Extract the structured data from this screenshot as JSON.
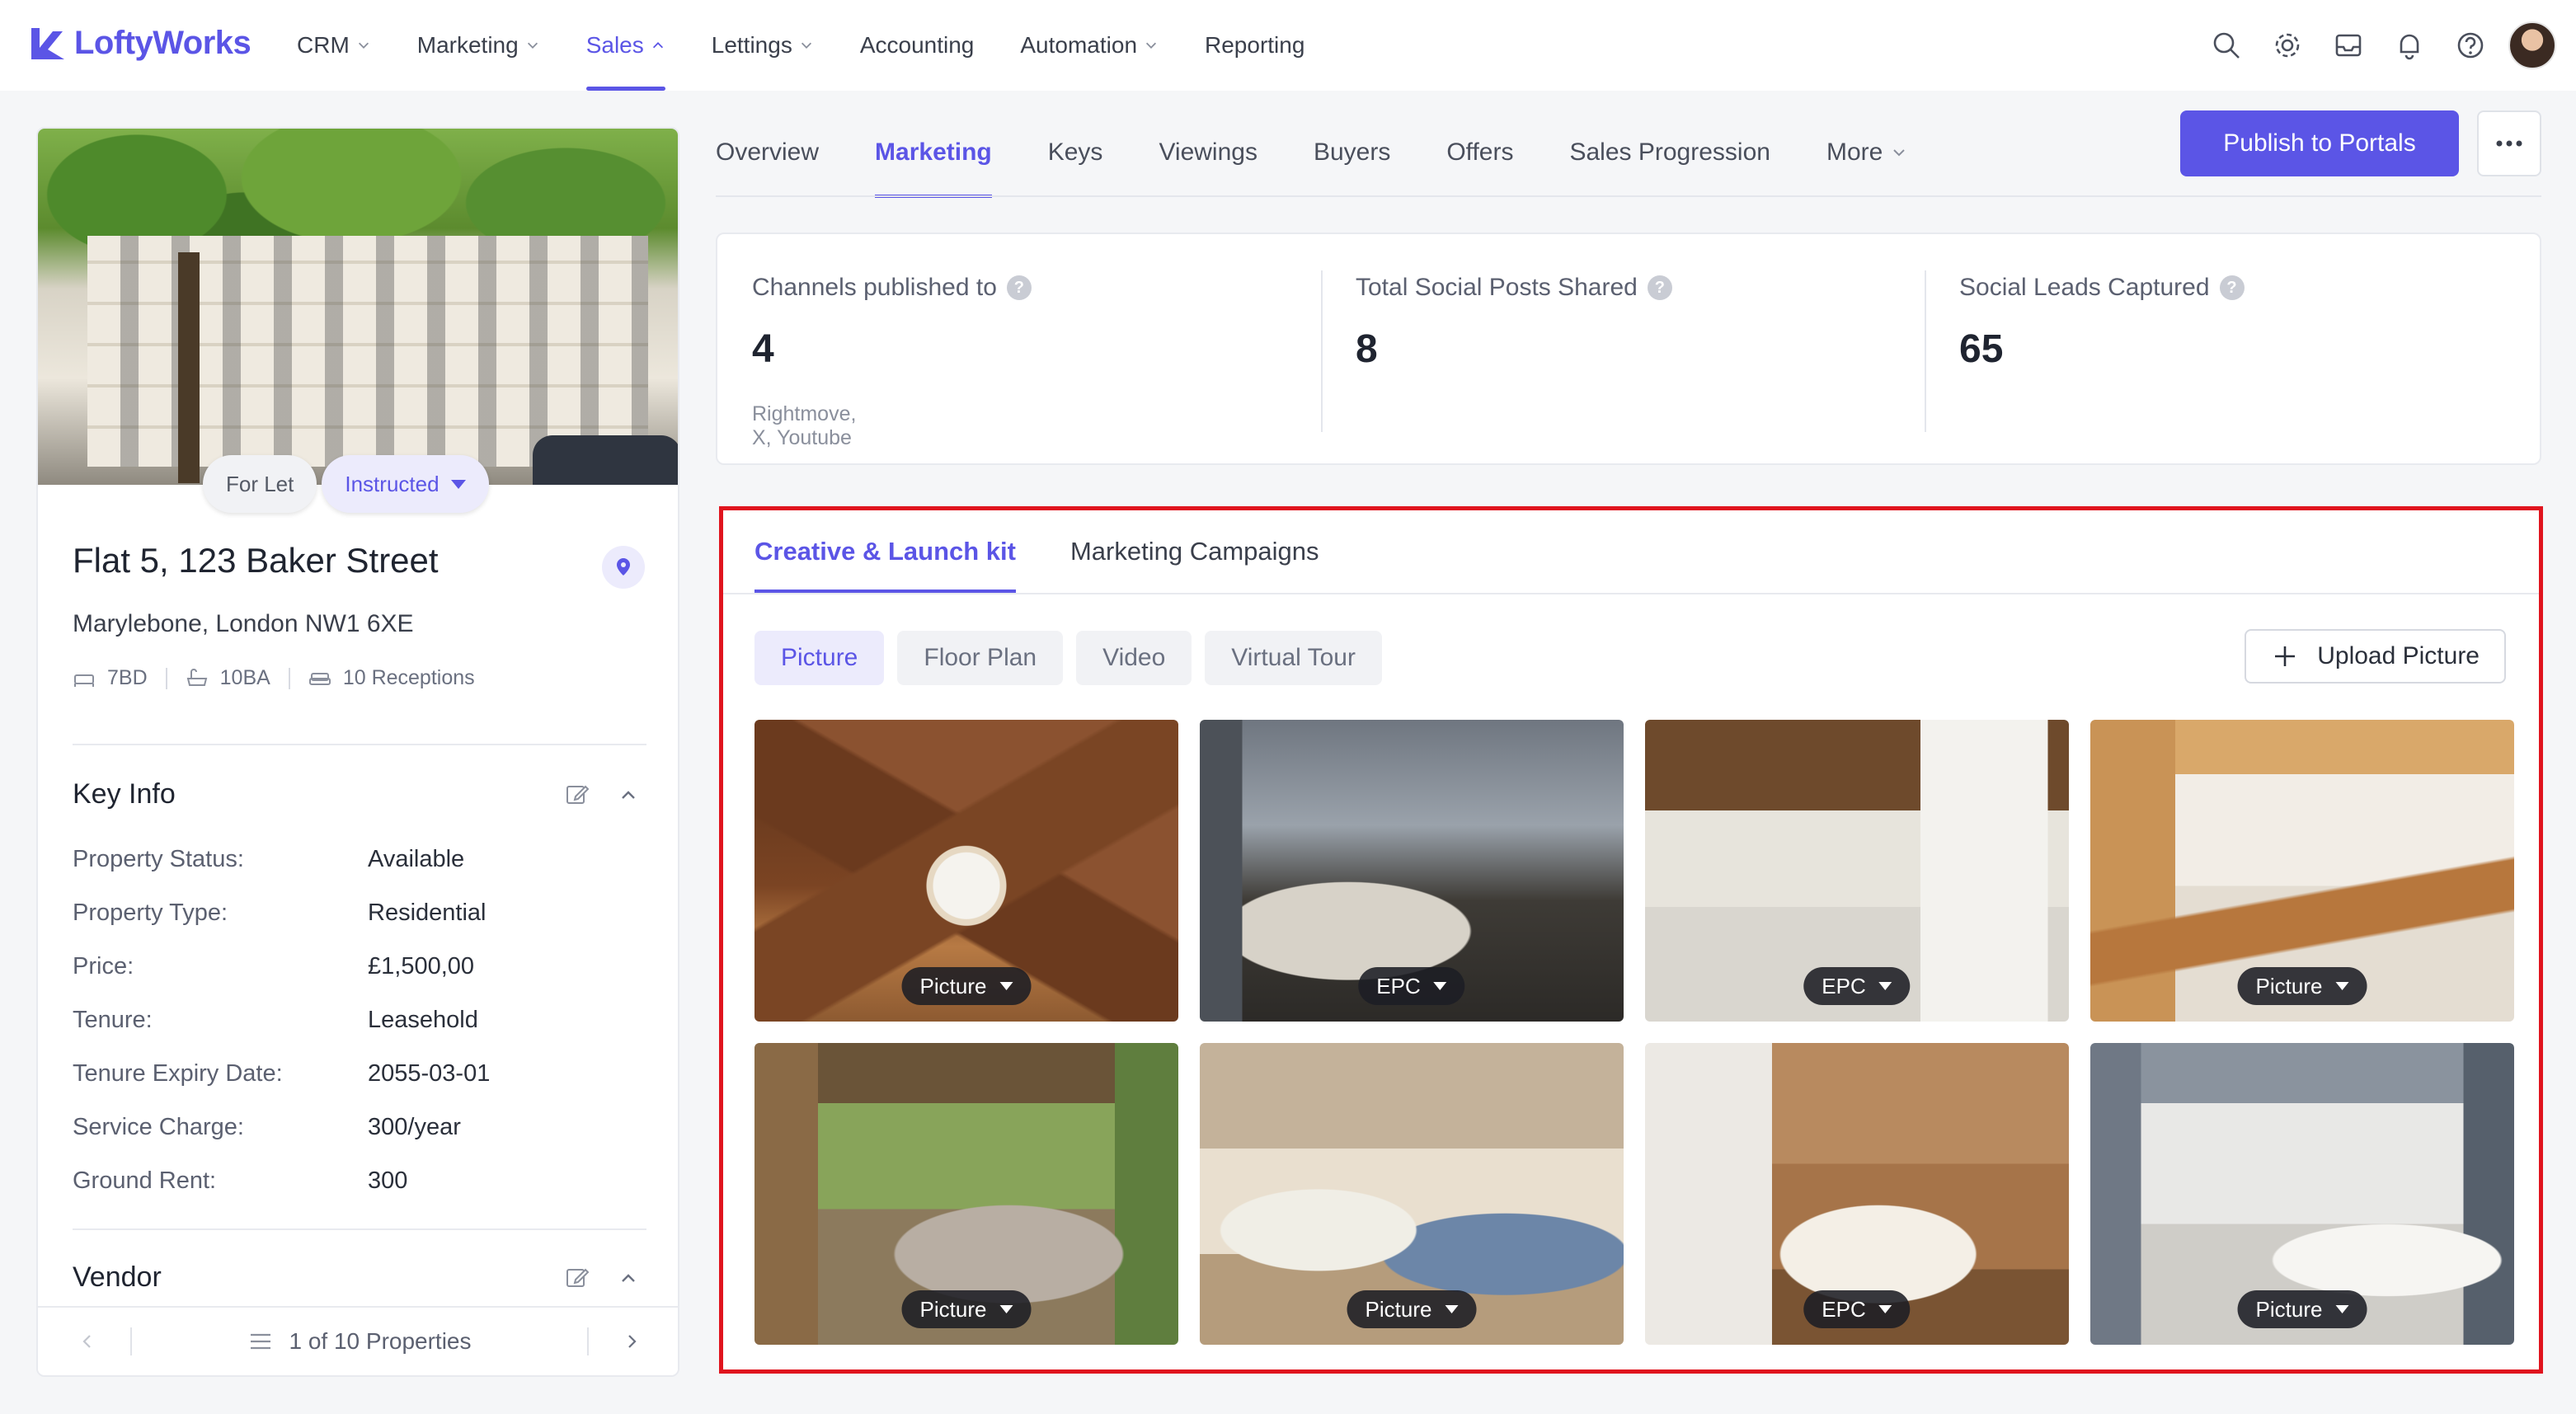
{
  "brand": {
    "name": "LoftyWorks",
    "accent": "#5b55e6",
    "highlight": "#e0141e"
  },
  "topnav": {
    "items": [
      {
        "label": "CRM",
        "dropdown": true,
        "active": false
      },
      {
        "label": "Marketing",
        "dropdown": true,
        "active": false
      },
      {
        "label": "Sales",
        "dropdown": true,
        "active": true
      },
      {
        "label": "Lettings",
        "dropdown": true,
        "active": false
      },
      {
        "label": "Accounting",
        "dropdown": false,
        "active": false
      },
      {
        "label": "Automation",
        "dropdown": true,
        "active": false
      },
      {
        "label": "Reporting",
        "dropdown": false,
        "active": false
      }
    ],
    "icons": [
      "search-icon",
      "gear-icon",
      "inbox-icon",
      "bell-icon",
      "help-icon"
    ]
  },
  "property": {
    "pills": {
      "listing_type": "For Let",
      "status": "Instructed"
    },
    "title": "Flat 5, 123 Baker Street",
    "address": "Marylebone, London NW1 6XE",
    "meta": {
      "beds": "7BD",
      "baths": "10BA",
      "receptions": "10 Receptions"
    }
  },
  "key_info": {
    "heading": "Key Info",
    "rows": [
      {
        "label": "Property Status:",
        "value": "Available"
      },
      {
        "label": "Property Type:",
        "value": "Residential"
      },
      {
        "label": "Price:",
        "value": "£1,500,00"
      },
      {
        "label": "Tenure:",
        "value": "Leasehold"
      },
      {
        "label": "Tenure Expiry Date:",
        "value": "2055-03-01"
      },
      {
        "label": "Service Charge:",
        "value": "300/year"
      },
      {
        "label": "Ground Rent:",
        "value": "300"
      }
    ]
  },
  "vendor": {
    "heading": "Vendor"
  },
  "pager": {
    "text": "1 of 10 Properties"
  },
  "tabs": {
    "items": [
      "Overview",
      "Marketing",
      "Keys",
      "Viewings",
      "Buyers",
      "Offers",
      "Sales Progression",
      "More"
    ],
    "active": "Marketing"
  },
  "actions": {
    "publish_label": "Publish to Portals"
  },
  "stats": [
    {
      "label": "Channels published to",
      "value": "4",
      "sub": "Rightmove, X, Youtube"
    },
    {
      "label": "Total Social Posts Shared",
      "value": "8",
      "sub": ""
    },
    {
      "label": "Social Leads Captured",
      "value": "65",
      "sub": ""
    }
  ],
  "kit": {
    "tabs": [
      "Creative & Launch kit",
      "Marketing Campaigns"
    ],
    "active_tab": "Creative & Launch kit",
    "filters": [
      "Picture",
      "Floor Plan",
      "Video",
      "Virtual Tour"
    ],
    "active_filter": "Picture",
    "upload_label": "Upload Picture",
    "photos": [
      {
        "tag": "Picture"
      },
      {
        "tag": "EPC"
      },
      {
        "tag": "EPC"
      },
      {
        "tag": "Picture"
      },
      {
        "tag": "Picture"
      },
      {
        "tag": "Picture"
      },
      {
        "tag": "EPC"
      },
      {
        "tag": "Picture"
      }
    ]
  }
}
